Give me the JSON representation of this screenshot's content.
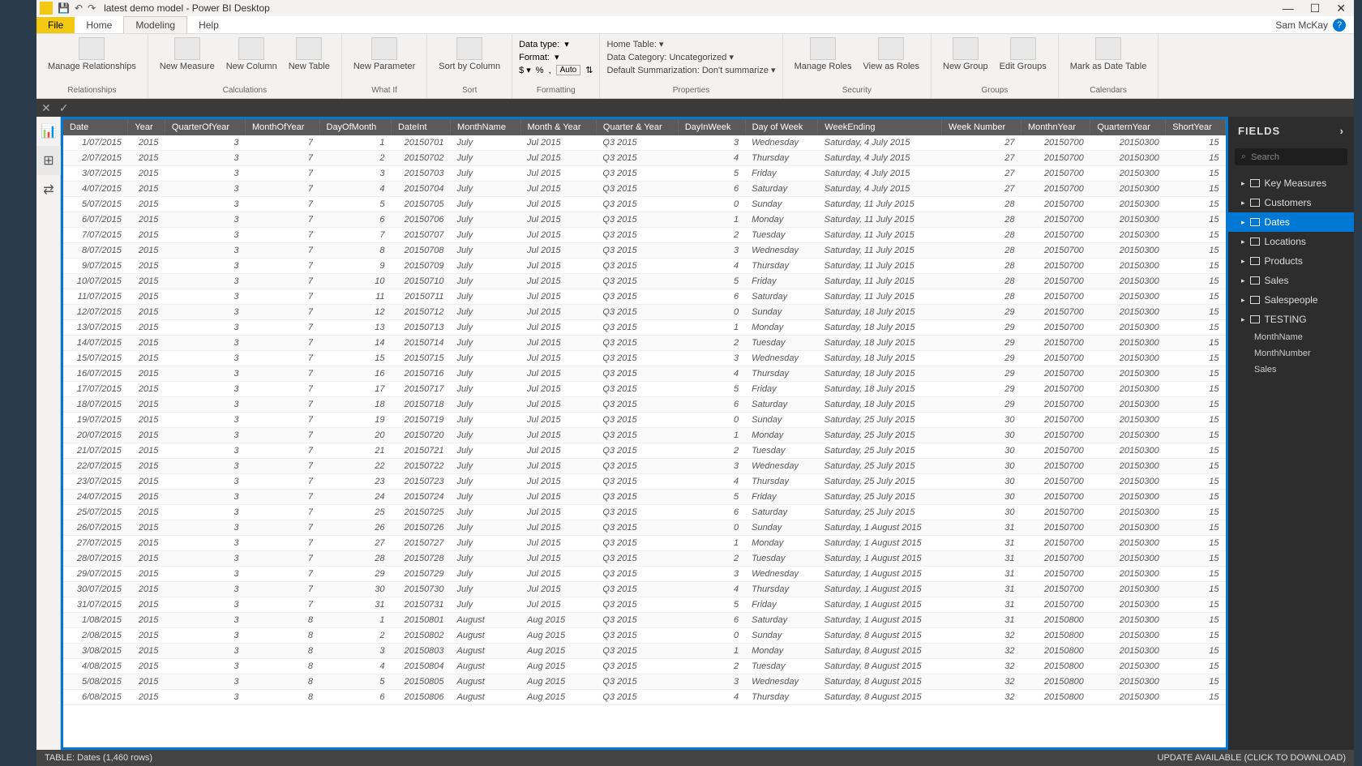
{
  "window": {
    "title": "latest demo model - Power BI Desktop",
    "user": "Sam McKay"
  },
  "tabs": {
    "file": "File",
    "home": "Home",
    "modeling": "Modeling",
    "help": "Help"
  },
  "ribbon": {
    "relationships": {
      "manage": "Manage\nRelationships",
      "group": "Relationships"
    },
    "calculations": {
      "measure": "New\nMeasure",
      "column": "New\nColumn",
      "table": "New\nTable",
      "group": "Calculations"
    },
    "whatif": {
      "param": "New\nParameter",
      "group": "What If"
    },
    "sort": {
      "sortby": "Sort by\nColumn",
      "group": "Sort"
    },
    "formatting": {
      "datatype": "Data type:",
      "format": "Format:",
      "auto": "Auto",
      "group": "Formatting"
    },
    "properties": {
      "hometable": "Home Table:",
      "category": "Data Category: Uncategorized",
      "summarization": "Default Summarization: Don't summarize",
      "group": "Properties"
    },
    "security": {
      "manage": "Manage\nRoles",
      "viewas": "View as\nRoles",
      "group": "Security"
    },
    "groups": {
      "new": "New\nGroup",
      "edit": "Edit\nGroups",
      "group": "Groups"
    },
    "calendars": {
      "mark": "Mark as\nDate Table",
      "group": "Calendars"
    }
  },
  "fields": {
    "title": "FIELDS",
    "search": "Search",
    "tables": [
      "Key Measures",
      "Customers",
      "Dates",
      "Locations",
      "Products",
      "Sales",
      "Salespeople",
      "TESTING"
    ],
    "testing_cols": [
      "MonthName",
      "MonthNumber",
      "Sales"
    ]
  },
  "status": {
    "left": "TABLE: Dates (1,460 rows)",
    "right": "UPDATE AVAILABLE (CLICK TO DOWNLOAD)"
  },
  "columns": [
    "Date",
    "Year",
    "QuarterOfYear",
    "MonthOfYear",
    "DayOfMonth",
    "DateInt",
    "MonthName",
    "Month & Year",
    "Quarter & Year",
    "DayInWeek",
    "Day of Week",
    "WeekEnding",
    "Week Number",
    "MonthnYear",
    "QuarternYear",
    "ShortYear"
  ],
  "rows": [
    [
      "1/07/2015",
      "2015",
      "3",
      "7",
      "1",
      "20150701",
      "July",
      "Jul 2015",
      "Q3 2015",
      "3",
      "Wednesday",
      "Saturday, 4 July 2015",
      "27",
      "20150700",
      "20150300",
      "15"
    ],
    [
      "2/07/2015",
      "2015",
      "3",
      "7",
      "2",
      "20150702",
      "July",
      "Jul 2015",
      "Q3 2015",
      "4",
      "Thursday",
      "Saturday, 4 July 2015",
      "27",
      "20150700",
      "20150300",
      "15"
    ],
    [
      "3/07/2015",
      "2015",
      "3",
      "7",
      "3",
      "20150703",
      "July",
      "Jul 2015",
      "Q3 2015",
      "5",
      "Friday",
      "Saturday, 4 July 2015",
      "27",
      "20150700",
      "20150300",
      "15"
    ],
    [
      "4/07/2015",
      "2015",
      "3",
      "7",
      "4",
      "20150704",
      "July",
      "Jul 2015",
      "Q3 2015",
      "6",
      "Saturday",
      "Saturday, 4 July 2015",
      "27",
      "20150700",
      "20150300",
      "15"
    ],
    [
      "5/07/2015",
      "2015",
      "3",
      "7",
      "5",
      "20150705",
      "July",
      "Jul 2015",
      "Q3 2015",
      "0",
      "Sunday",
      "Saturday, 11 July 2015",
      "28",
      "20150700",
      "20150300",
      "15"
    ],
    [
      "6/07/2015",
      "2015",
      "3",
      "7",
      "6",
      "20150706",
      "July",
      "Jul 2015",
      "Q3 2015",
      "1",
      "Monday",
      "Saturday, 11 July 2015",
      "28",
      "20150700",
      "20150300",
      "15"
    ],
    [
      "7/07/2015",
      "2015",
      "3",
      "7",
      "7",
      "20150707",
      "July",
      "Jul 2015",
      "Q3 2015",
      "2",
      "Tuesday",
      "Saturday, 11 July 2015",
      "28",
      "20150700",
      "20150300",
      "15"
    ],
    [
      "8/07/2015",
      "2015",
      "3",
      "7",
      "8",
      "20150708",
      "July",
      "Jul 2015",
      "Q3 2015",
      "3",
      "Wednesday",
      "Saturday, 11 July 2015",
      "28",
      "20150700",
      "20150300",
      "15"
    ],
    [
      "9/07/2015",
      "2015",
      "3",
      "7",
      "9",
      "20150709",
      "July",
      "Jul 2015",
      "Q3 2015",
      "4",
      "Thursday",
      "Saturday, 11 July 2015",
      "28",
      "20150700",
      "20150300",
      "15"
    ],
    [
      "10/07/2015",
      "2015",
      "3",
      "7",
      "10",
      "20150710",
      "July",
      "Jul 2015",
      "Q3 2015",
      "5",
      "Friday",
      "Saturday, 11 July 2015",
      "28",
      "20150700",
      "20150300",
      "15"
    ],
    [
      "11/07/2015",
      "2015",
      "3",
      "7",
      "11",
      "20150711",
      "July",
      "Jul 2015",
      "Q3 2015",
      "6",
      "Saturday",
      "Saturday, 11 July 2015",
      "28",
      "20150700",
      "20150300",
      "15"
    ],
    [
      "12/07/2015",
      "2015",
      "3",
      "7",
      "12",
      "20150712",
      "July",
      "Jul 2015",
      "Q3 2015",
      "0",
      "Sunday",
      "Saturday, 18 July 2015",
      "29",
      "20150700",
      "20150300",
      "15"
    ],
    [
      "13/07/2015",
      "2015",
      "3",
      "7",
      "13",
      "20150713",
      "July",
      "Jul 2015",
      "Q3 2015",
      "1",
      "Monday",
      "Saturday, 18 July 2015",
      "29",
      "20150700",
      "20150300",
      "15"
    ],
    [
      "14/07/2015",
      "2015",
      "3",
      "7",
      "14",
      "20150714",
      "July",
      "Jul 2015",
      "Q3 2015",
      "2",
      "Tuesday",
      "Saturday, 18 July 2015",
      "29",
      "20150700",
      "20150300",
      "15"
    ],
    [
      "15/07/2015",
      "2015",
      "3",
      "7",
      "15",
      "20150715",
      "July",
      "Jul 2015",
      "Q3 2015",
      "3",
      "Wednesday",
      "Saturday, 18 July 2015",
      "29",
      "20150700",
      "20150300",
      "15"
    ],
    [
      "16/07/2015",
      "2015",
      "3",
      "7",
      "16",
      "20150716",
      "July",
      "Jul 2015",
      "Q3 2015",
      "4",
      "Thursday",
      "Saturday, 18 July 2015",
      "29",
      "20150700",
      "20150300",
      "15"
    ],
    [
      "17/07/2015",
      "2015",
      "3",
      "7",
      "17",
      "20150717",
      "July",
      "Jul 2015",
      "Q3 2015",
      "5",
      "Friday",
      "Saturday, 18 July 2015",
      "29",
      "20150700",
      "20150300",
      "15"
    ],
    [
      "18/07/2015",
      "2015",
      "3",
      "7",
      "18",
      "20150718",
      "July",
      "Jul 2015",
      "Q3 2015",
      "6",
      "Saturday",
      "Saturday, 18 July 2015",
      "29",
      "20150700",
      "20150300",
      "15"
    ],
    [
      "19/07/2015",
      "2015",
      "3",
      "7",
      "19",
      "20150719",
      "July",
      "Jul 2015",
      "Q3 2015",
      "0",
      "Sunday",
      "Saturday, 25 July 2015",
      "30",
      "20150700",
      "20150300",
      "15"
    ],
    [
      "20/07/2015",
      "2015",
      "3",
      "7",
      "20",
      "20150720",
      "July",
      "Jul 2015",
      "Q3 2015",
      "1",
      "Monday",
      "Saturday, 25 July 2015",
      "30",
      "20150700",
      "20150300",
      "15"
    ],
    [
      "21/07/2015",
      "2015",
      "3",
      "7",
      "21",
      "20150721",
      "July",
      "Jul 2015",
      "Q3 2015",
      "2",
      "Tuesday",
      "Saturday, 25 July 2015",
      "30",
      "20150700",
      "20150300",
      "15"
    ],
    [
      "22/07/2015",
      "2015",
      "3",
      "7",
      "22",
      "20150722",
      "July",
      "Jul 2015",
      "Q3 2015",
      "3",
      "Wednesday",
      "Saturday, 25 July 2015",
      "30",
      "20150700",
      "20150300",
      "15"
    ],
    [
      "23/07/2015",
      "2015",
      "3",
      "7",
      "23",
      "20150723",
      "July",
      "Jul 2015",
      "Q3 2015",
      "4",
      "Thursday",
      "Saturday, 25 July 2015",
      "30",
      "20150700",
      "20150300",
      "15"
    ],
    [
      "24/07/2015",
      "2015",
      "3",
      "7",
      "24",
      "20150724",
      "July",
      "Jul 2015",
      "Q3 2015",
      "5",
      "Friday",
      "Saturday, 25 July 2015",
      "30",
      "20150700",
      "20150300",
      "15"
    ],
    [
      "25/07/2015",
      "2015",
      "3",
      "7",
      "25",
      "20150725",
      "July",
      "Jul 2015",
      "Q3 2015",
      "6",
      "Saturday",
      "Saturday, 25 July 2015",
      "30",
      "20150700",
      "20150300",
      "15"
    ],
    [
      "26/07/2015",
      "2015",
      "3",
      "7",
      "26",
      "20150726",
      "July",
      "Jul 2015",
      "Q3 2015",
      "0",
      "Sunday",
      "Saturday, 1 August 2015",
      "31",
      "20150700",
      "20150300",
      "15"
    ],
    [
      "27/07/2015",
      "2015",
      "3",
      "7",
      "27",
      "20150727",
      "July",
      "Jul 2015",
      "Q3 2015",
      "1",
      "Monday",
      "Saturday, 1 August 2015",
      "31",
      "20150700",
      "20150300",
      "15"
    ],
    [
      "28/07/2015",
      "2015",
      "3",
      "7",
      "28",
      "20150728",
      "July",
      "Jul 2015",
      "Q3 2015",
      "2",
      "Tuesday",
      "Saturday, 1 August 2015",
      "31",
      "20150700",
      "20150300",
      "15"
    ],
    [
      "29/07/2015",
      "2015",
      "3",
      "7",
      "29",
      "20150729",
      "July",
      "Jul 2015",
      "Q3 2015",
      "3",
      "Wednesday",
      "Saturday, 1 August 2015",
      "31",
      "20150700",
      "20150300",
      "15"
    ],
    [
      "30/07/2015",
      "2015",
      "3",
      "7",
      "30",
      "20150730",
      "July",
      "Jul 2015",
      "Q3 2015",
      "4",
      "Thursday",
      "Saturday, 1 August 2015",
      "31",
      "20150700",
      "20150300",
      "15"
    ],
    [
      "31/07/2015",
      "2015",
      "3",
      "7",
      "31",
      "20150731",
      "July",
      "Jul 2015",
      "Q3 2015",
      "5",
      "Friday",
      "Saturday, 1 August 2015",
      "31",
      "20150700",
      "20150300",
      "15"
    ],
    [
      "1/08/2015",
      "2015",
      "3",
      "8",
      "1",
      "20150801",
      "August",
      "Aug 2015",
      "Q3 2015",
      "6",
      "Saturday",
      "Saturday, 1 August 2015",
      "31",
      "20150800",
      "20150300",
      "15"
    ],
    [
      "2/08/2015",
      "2015",
      "3",
      "8",
      "2",
      "20150802",
      "August",
      "Aug 2015",
      "Q3 2015",
      "0",
      "Sunday",
      "Saturday, 8 August 2015",
      "32",
      "20150800",
      "20150300",
      "15"
    ],
    [
      "3/08/2015",
      "2015",
      "3",
      "8",
      "3",
      "20150803",
      "August",
      "Aug 2015",
      "Q3 2015",
      "1",
      "Monday",
      "Saturday, 8 August 2015",
      "32",
      "20150800",
      "20150300",
      "15"
    ],
    [
      "4/08/2015",
      "2015",
      "3",
      "8",
      "4",
      "20150804",
      "August",
      "Aug 2015",
      "Q3 2015",
      "2",
      "Tuesday",
      "Saturday, 8 August 2015",
      "32",
      "20150800",
      "20150300",
      "15"
    ],
    [
      "5/08/2015",
      "2015",
      "3",
      "8",
      "5",
      "20150805",
      "August",
      "Aug 2015",
      "Q3 2015",
      "3",
      "Wednesday",
      "Saturday, 8 August 2015",
      "32",
      "20150800",
      "20150300",
      "15"
    ],
    [
      "6/08/2015",
      "2015",
      "3",
      "8",
      "6",
      "20150806",
      "August",
      "Aug 2015",
      "Q3 2015",
      "4",
      "Thursday",
      "Saturday, 8 August 2015",
      "32",
      "20150800",
      "20150300",
      "15"
    ]
  ]
}
